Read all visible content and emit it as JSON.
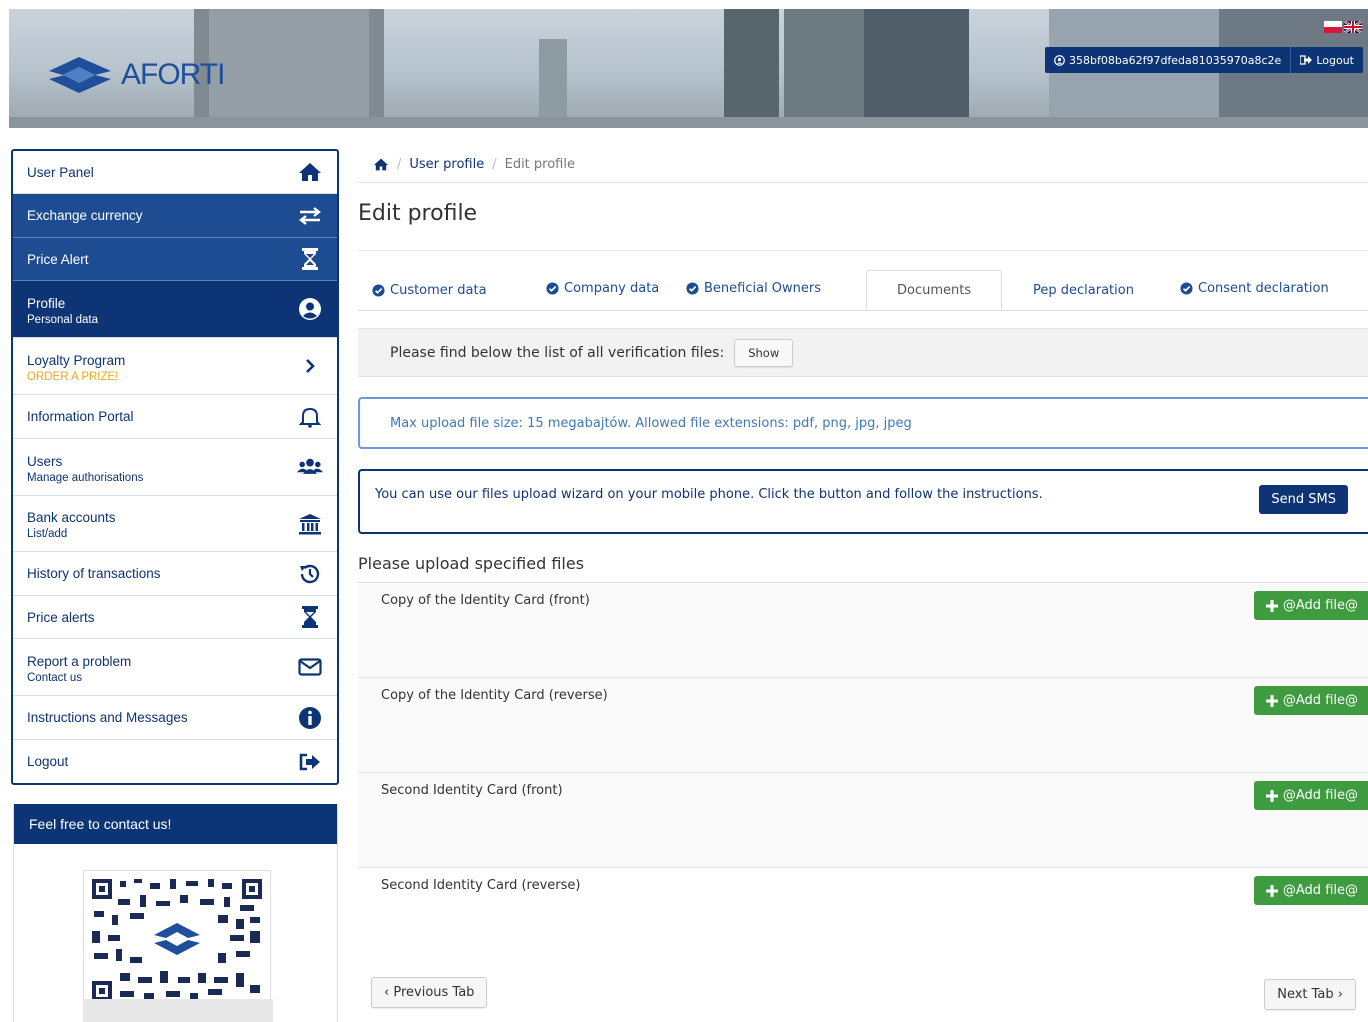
{
  "header": {
    "logo_text": "AFORTI",
    "user_id": "358bf08ba62f97dfeda81035970a8c2e",
    "logout": "Logout"
  },
  "sidebar": {
    "items": [
      {
        "label": "User Panel",
        "sub": "",
        "icon": "home-icon"
      },
      {
        "label": "Exchange currency",
        "sub": "",
        "icon": "exchange-icon"
      },
      {
        "label": "Price Alert",
        "sub": "",
        "icon": "hourglass-icon"
      },
      {
        "label": "Profile",
        "sub": "Personal data",
        "icon": "user-circle-icon"
      },
      {
        "label": "Loyalty Program",
        "sub": "ORDER A PRIZE!",
        "icon": "chevron-right-icon"
      },
      {
        "label": "Information Portal",
        "sub": "",
        "icon": "bell-icon"
      },
      {
        "label": "Users",
        "sub": "Manage authorisations",
        "icon": "users-icon"
      },
      {
        "label": "Bank accounts",
        "sub": "List/add",
        "icon": "bank-icon"
      },
      {
        "label": "History of transactions",
        "sub": "",
        "icon": "history-icon"
      },
      {
        "label": "Price alerts",
        "sub": "",
        "icon": "hourglass-icon"
      },
      {
        "label": "Report a problem",
        "sub": "Contact us",
        "icon": "envelope-icon"
      },
      {
        "label": "Instructions and Messages",
        "sub": "",
        "icon": "info-icon"
      },
      {
        "label": "Logout",
        "sub": "",
        "icon": "sign-out-icon"
      }
    ]
  },
  "contact": {
    "title": "Feel free to contact us!"
  },
  "breadcrumb": {
    "link": "User profile",
    "current": "Edit profile"
  },
  "page_title": "Edit profile",
  "tabs": [
    {
      "label": "Customer data",
      "checked": true
    },
    {
      "label": "Company data",
      "checked": true
    },
    {
      "label": "Beneficial Owners",
      "checked": true
    },
    {
      "label": "Documents",
      "checked": false
    },
    {
      "label": "Pep declaration",
      "checked": false
    },
    {
      "label": "Consent declaration",
      "checked": true
    }
  ],
  "verification": {
    "text": "Please find below the list of all verification files:",
    "button": "Show"
  },
  "upload_limit": "Max upload file size: 15 megabajtów. Allowed file extensions: pdf, png, jpg, jpeg",
  "sms": {
    "text": "You can use our files upload wizard on your mobile phone. Click the button and follow the instructions.",
    "button": "Send SMS"
  },
  "upload_title": "Please upload specified files",
  "files": [
    {
      "name": "Copy of the Identity Card (front)",
      "button": "@Add file@"
    },
    {
      "name": "Copy of the Identity Card (reverse)",
      "button": "@Add file@"
    },
    {
      "name": "Second Identity Card (front)",
      "button": "@Add file@"
    },
    {
      "name": "Second Identity Card (reverse)",
      "button": "@Add file@"
    }
  ],
  "nav": {
    "prev": "Previous Tab",
    "next": "Next Tab"
  },
  "colors": {
    "brand_dark": "#0d3475",
    "brand_mid": "#1d4c92",
    "success": "#3f9b3f",
    "promo": "#f0a61b"
  }
}
